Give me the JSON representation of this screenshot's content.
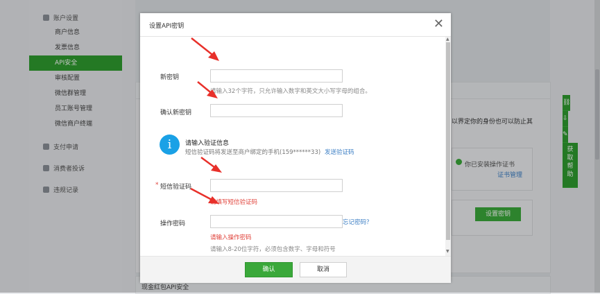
{
  "sidebar": {
    "group_account": "账户设置",
    "items": [
      {
        "label": "商户信息"
      },
      {
        "label": "发票信息"
      },
      {
        "label": "API安全"
      },
      {
        "label": "审核配置"
      },
      {
        "label": "微信群管理"
      },
      {
        "label": "员工账号管理"
      },
      {
        "label": "微信商户终端"
      }
    ],
    "group_pay": "支付申请",
    "group_complaint": "消费者投诉",
    "group_violation": "违规记录"
  },
  "background": {
    "partial_text": "以界定你的身份也可以防止其",
    "cert_status": "你已安装操作证书",
    "cert_manage_link": "证书管理",
    "set_key_button": "设置密钥",
    "bottom_text": "现金红包API安全"
  },
  "help_toolbar": {
    "help_label": "获取帮助"
  },
  "modal": {
    "title": "设置API密钥",
    "new_key": {
      "label": "新密钥",
      "value": "",
      "hint": "请输入32个字符，只允许输入数字和英文大小写字母的组合。"
    },
    "confirm_key": {
      "label": "确认新密钥",
      "value": ""
    },
    "verify": {
      "title": "请输入验证信息",
      "desc": "短信验证码将发送至商户绑定的手机(159******33)",
      "send_link": "发送验证码",
      "icon": "info-icon"
    },
    "sms_code": {
      "required_mark": "*",
      "label": "短信验证码",
      "value": "",
      "error": "请填写短信验证码"
    },
    "op_password": {
      "label": "操作密码",
      "value": "",
      "forgot_link": "忘记密码？",
      "error": "请输入操作密码",
      "hint": "请输入8-20位字符，必须包含数字、字母和符号"
    },
    "confirm_button": "确认",
    "cancel_button": "取消"
  },
  "colors": {
    "brand_green": "#3aa83a",
    "error_red": "#e0423a",
    "info_blue": "#1aa1e6",
    "arrow_red": "#e8302a"
  }
}
